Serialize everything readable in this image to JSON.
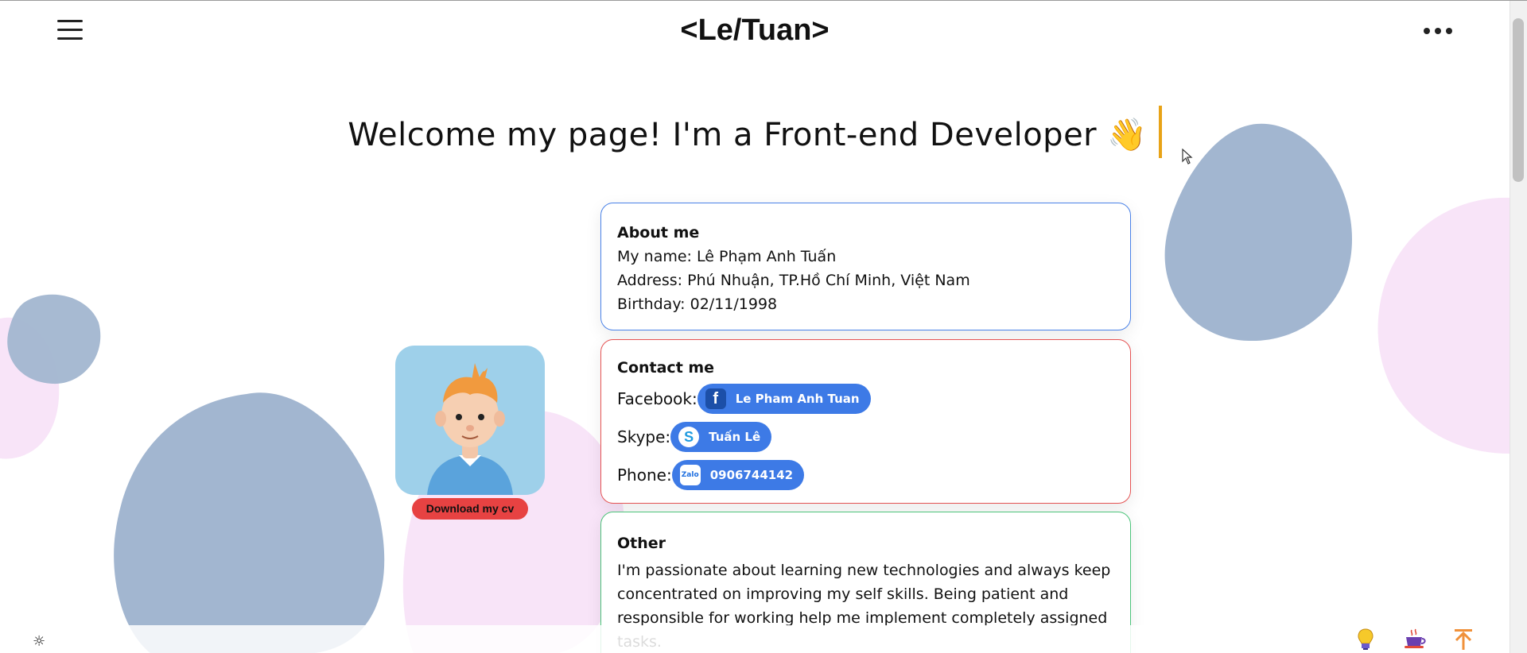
{
  "header": {
    "logo": "<Le/Tuan>"
  },
  "hero": {
    "welcome": "Welcome my page! I'm a Front-end Developer 👋"
  },
  "avatar": {
    "download_label": "Download my cv"
  },
  "about": {
    "title": "About me",
    "name": "My name: Lê Phạm Anh Tuấn",
    "address": "Address: Phú Nhuận, TP.Hồ Chí Minh, Việt Nam",
    "birthday": "Birthday: 02/11/1998"
  },
  "contact": {
    "title": "Contact me",
    "facebook_label": "Facebook:",
    "facebook_value": "Le Pham Anh Tuan",
    "skype_label": "Skype:",
    "skype_value": "Tuấn Lê",
    "phone_label": "Phone:",
    "phone_value": "0906744142",
    "zalo_icon_text": "Zalo"
  },
  "other": {
    "title": "Other",
    "text": "I'm passionate about learning new technologies and always keep concentrated on improving my self skills. Being patient and responsible for working help me implement completely assigned tasks."
  },
  "icons": {
    "menu": "menu-icon",
    "more": "more-icon",
    "theme": "sun-icon",
    "bulb": "lightbulb-icon",
    "coffee": "coffee-icon",
    "to_top": "arrow-up-icon"
  },
  "colors": {
    "about_border": "#4a82e8",
    "contact_border": "#e55353",
    "other_border": "#4cc47a",
    "pill": "#3d7ae6",
    "download": "#e74242",
    "caret": "#e8a317",
    "blob_blue": "#a2b6d0",
    "blob_pink": "#f8e4f8"
  }
}
